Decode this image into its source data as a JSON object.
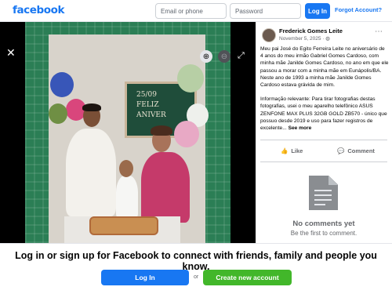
{
  "header": {
    "logo": "facebook",
    "email_placeholder": "Email or phone",
    "password_placeholder": "Password",
    "login_label": "Log In",
    "forgot_label": "Forgot Account?"
  },
  "photo_viewer": {
    "board_lines": [
      "25/09",
      "FELIZ",
      "ANIVER"
    ],
    "icons": {
      "close": "close-icon",
      "zoom_in": "zoom-in-icon",
      "zoom_out": "zoom-out-icon",
      "expand": "expand-icon"
    }
  },
  "post": {
    "author": "Frederick Gomes Leite",
    "date": "November 5, 2025",
    "privacy_icon": "globe-icon",
    "paragraph_1": "Meu pai José do Egito Ferreira Leite no aniversário de 4 anos do meu irmão Gabriel Gomes Cardoso, com minha mãe Janilde Gomes Cardoso, no ano em que ele passou a morar com a minha mãe em Eunápolis/BA. Neste ano de 1993 a minha mãe Janilde Gomes Cardoso estava grávida de mim.",
    "paragraph_2": "Informação relevante: Para tirar fotografias destas fotografias, usei o meu aparelho telefônico ASUS ZENFONE MAX PLUS 32GB GOLD ZB570 - único que possuo desde 2019 e uso para fazer registros de excelente...",
    "see_more": "See more",
    "like_label": "Like",
    "comment_label": "Comment"
  },
  "comments": {
    "empty_title": "No comments yet",
    "empty_subtitle": "Be the first to comment."
  },
  "footer": {
    "cta": "Log in or sign up for Facebook to connect with friends, family and people you know.",
    "login_label": "Log In",
    "or_label": "or",
    "create_label": "Create new account"
  },
  "colors": {
    "brand": "#1877f2",
    "create": "#42b72a"
  }
}
